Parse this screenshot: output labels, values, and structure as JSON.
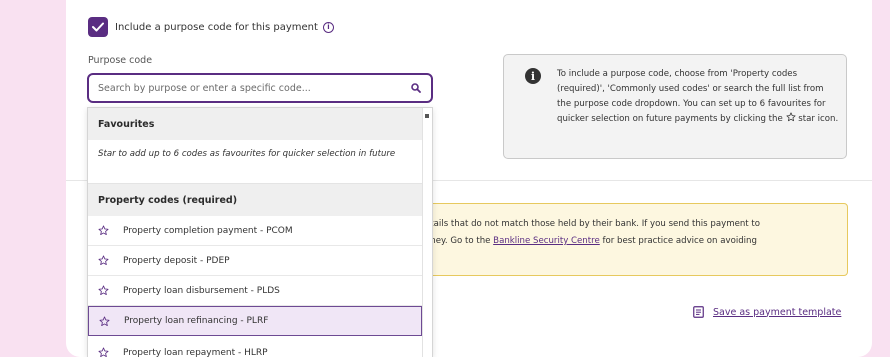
{
  "purpose_toggle": {
    "label": "Include a purpose code for this payment",
    "info": "i",
    "checked": true
  },
  "purpose_field": {
    "label": "Purpose code",
    "placeholder": "Search by purpose or enter a specific code..."
  },
  "info_panel": {
    "icon_letter": "i",
    "text_before": "To include a purpose code, choose from 'Property codes (required)', 'Commonly used codes' or search the full list from the purpose code dropdown. You can set up to 6 favourites for quicker selection on future payments by clicking the ",
    "text_after": " star icon."
  },
  "warning": {
    "line1": "etails that do not match those held by their bank. If you send this payment to",
    "line2_before": "oney. Go to the ",
    "link": "Bankline Security Centre",
    "line2_after": " for best practice advice on avoiding"
  },
  "template_link": "Save as payment template",
  "dropdown": {
    "favourites_header": "Favourites",
    "favourites_hint": "Star to add up to 6 codes as favourites for quicker selection in future",
    "property_header": "Property codes (required)",
    "options": [
      "Property completion payment - PCOM",
      "Property deposit - PDEP",
      "Property loan disbursement - PLDS",
      "Property loan refinancing - PLRF",
      "Property loan repayment - HLRP"
    ],
    "selected_index": 3
  },
  "colors": {
    "accent": "#5a2d82",
    "background": "#f9e1f1",
    "warning_bg": "#fdf7e0",
    "warning_border": "#e7c95e"
  },
  "icons": {
    "checkbox": "check-icon",
    "search": "search-icon",
    "info": "info-icon",
    "star": "star-outline-icon",
    "template": "document-icon"
  }
}
